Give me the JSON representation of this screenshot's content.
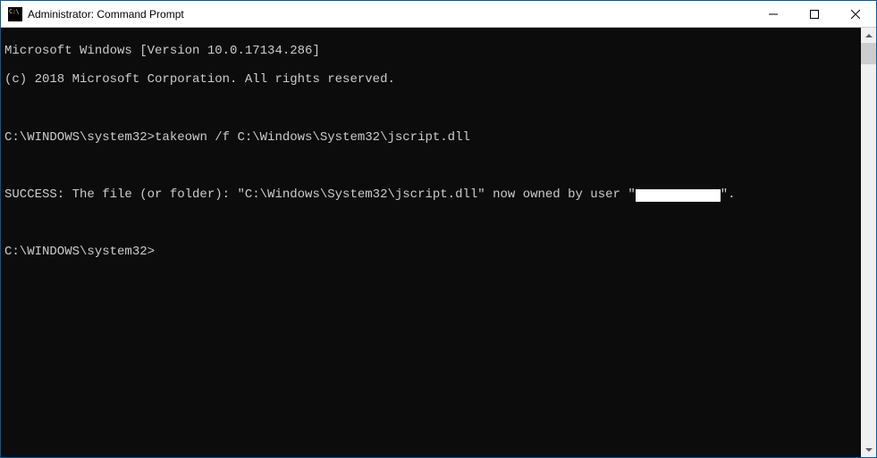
{
  "window": {
    "title": "Administrator: Command Prompt"
  },
  "console": {
    "line1": "Microsoft Windows [Version 10.0.17134.286]",
    "line2": "(c) 2018 Microsoft Corporation. All rights reserved.",
    "blank1": "",
    "prompt1_prefix": "C:\\WINDOWS\\system32>",
    "prompt1_cmd": "takeown /f C:\\Windows\\System32\\jscript.dll",
    "blank2": "",
    "success_pre": "SUCCESS: The file (or folder): \"C:\\Windows\\System32\\jscript.dll\" now owned by user \"",
    "success_post": "\".",
    "blank3": "",
    "prompt2_prefix": "C:\\WINDOWS\\system32>"
  }
}
